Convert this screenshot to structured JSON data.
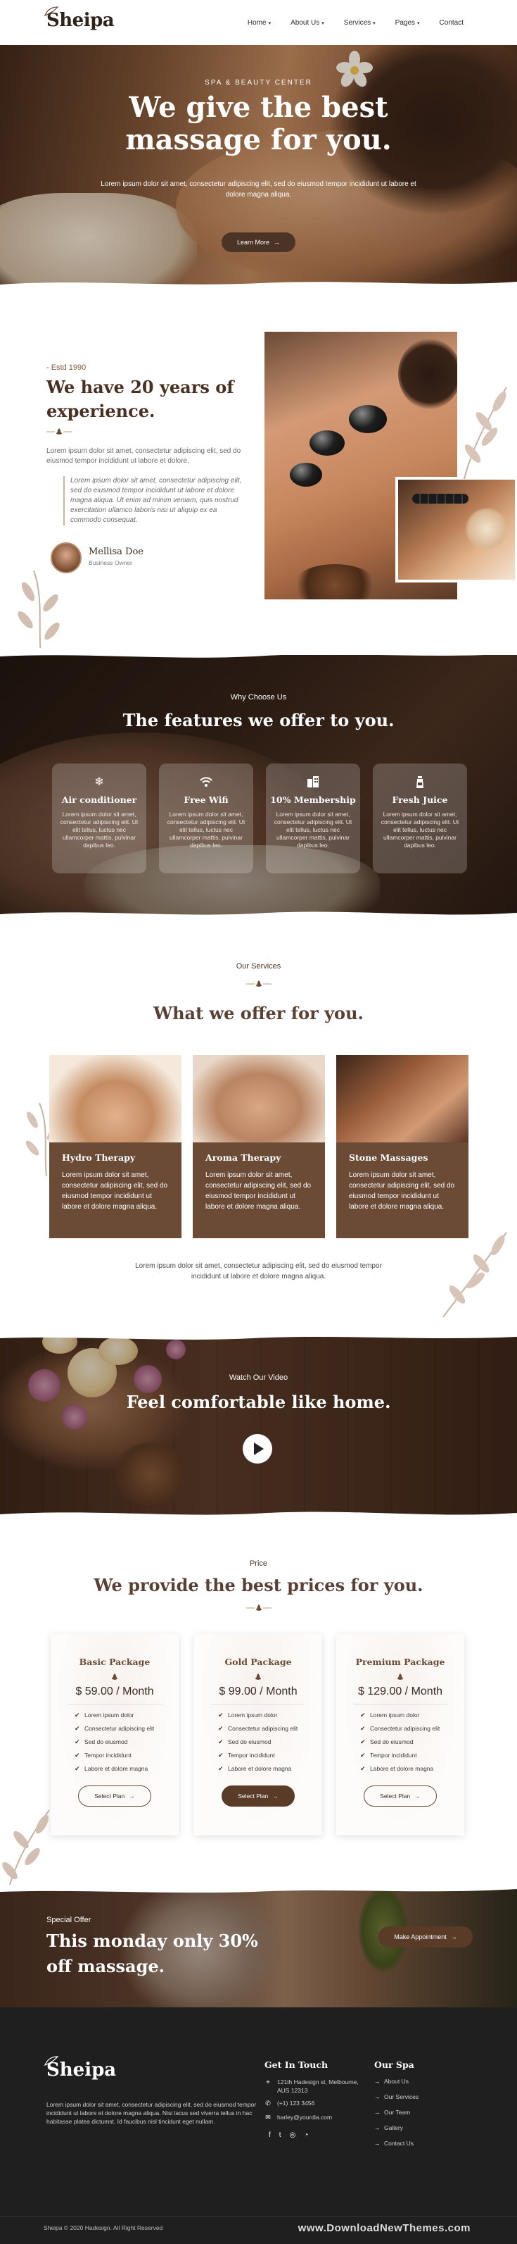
{
  "brand": {
    "logo_text": "Sheipa"
  },
  "nav": {
    "items": [
      {
        "label": "Home",
        "has_dropdown": true
      },
      {
        "label": "About Us",
        "has_dropdown": true
      },
      {
        "label": "Services",
        "has_dropdown": true
      },
      {
        "label": "Pages",
        "has_dropdown": true
      },
      {
        "label": "Contact",
        "has_dropdown": false
      }
    ]
  },
  "hero": {
    "eyebrow": "SPA & BEAUTY CENTER",
    "title_line1": "We give the best",
    "title_line2": "massage for you.",
    "text": "Lorem ipsum dolor sit amet, consectetur adipiscing elit, sed do eiusmod tempor incididunt ut labore et dolore magna aliqua.",
    "button": "Learn More"
  },
  "about": {
    "estd": "- Estd 1990",
    "title": "We have 20 years of experience.",
    "paragraph": "Lorem ipsum dolor sit amet, consectetur adipiscing elit, sed do eiusmod tempor incididunt ut labore et dolore.",
    "quote": "Lorem ipsum dolor sit amet, consectetur adipiscing elit, sed do eiusmod tempor incididunt ut labore et dolore magna aliqua. Ut enim ad minim veniam, quis nostrud exercitation ullamco laboris nisi ut aliquip ex ea commodo consequat.",
    "author_name": "Mellisa Doe",
    "author_role": "Business Owner"
  },
  "features": {
    "eyebrow": "Why Choose Us",
    "title": "The features we offer to you.",
    "cards": [
      {
        "icon": "snowflake-icon",
        "title": "Air conditioner",
        "text": "Lorem ipsum dolor sit amet, consectetur adipiscing elit. Ut elit tellus, luctus nec ullamcorper mattis, pulvinar dapibus leo."
      },
      {
        "icon": "wifi-icon",
        "title": "Free Wifi",
        "text": "Lorem ipsum dolor sit amet, consectetur adipiscing elit. Ut elit tellus, luctus nec ullamcorper mattis, pulvinar dapibus leo."
      },
      {
        "icon": "building-icon",
        "title": "10% Membership",
        "text": "Lorem ipsum dolor sit amet, consectetur adipiscing elit. Ut elit tellus, luctus nec ullamcorper mattis, pulvinar dapibus leo."
      },
      {
        "icon": "juice-icon",
        "title": "Fresh Juice",
        "text": "Lorem ipsum dolor sit amet, consectetur adipiscing elit. Ut elit tellus, luctus nec ullamcorper mattis, pulvinar dapibus leo."
      }
    ]
  },
  "services": {
    "eyebrow": "Our Services",
    "title": "What we offer for you.",
    "cards": [
      {
        "title": "Hydro Therapy",
        "text": "Lorem ipsum dolor sit amet, consectetur adipiscing elit, sed do eiusmod tempor incididunt ut labore et dolore magna aliqua."
      },
      {
        "title": "Aroma Therapy",
        "text": "Lorem ipsum dolor sit amet, consectetur adipiscing elit, sed do eiusmod tempor incididunt ut labore et dolore magna aliqua."
      },
      {
        "title": "Stone Massages",
        "text": "Lorem ipsum dolor sit amet, consectetur adipiscing elit, sed do eiusmod tempor incididunt ut labore et dolore magna aliqua."
      }
    ],
    "note": "Lorem ipsum dolor sit amet, consectetur adipiscing elit, sed do eiusmod tempor incididunt ut labore et dolore magna aliqua."
  },
  "video": {
    "eyebrow": "Watch Our Video",
    "title": "Feel comfortable like home."
  },
  "pricing": {
    "eyebrow": "Price",
    "title": "We provide the best prices for you.",
    "plans": [
      {
        "name": "Basic Package",
        "price": "$ 59.00 / Month",
        "button": "Select Plan"
      },
      {
        "name": "Gold Package",
        "price": "$ 99.00 / Month",
        "button": "Select Plan"
      },
      {
        "name": "Premium Package",
        "price": "$ 129.00 / Month",
        "button": "Select Plan"
      }
    ],
    "features": [
      "Lorem ipsum dolor",
      "Consectetur adipiscing elit",
      "Sed do eiusmod",
      "Tempor incididunt",
      "Labore et dolore magna"
    ]
  },
  "offer": {
    "eyebrow": "Special Offer",
    "title": "This monday only 30% off massage.",
    "button": "Make Appointment"
  },
  "footer": {
    "logo_text": "Sheipa",
    "about": "Lorem ipsum dolor sit amet, consectetur adipiscing elit, sed do eiusmod tempor incididunt ut labore et dolore magna aliqua. Nisi lacus sed viverra tellus in hac habitasse platea dictumst. Id faucibus nisl tincidunt eget nullam.",
    "contact_title": "Get In Touch",
    "address_line1": "121th Hadesign st, Melbourne,",
    "address_line2": "AUS 12313",
    "phone": "(+1) 123 3456",
    "email": "harley@yourdia.com",
    "links_title": "Our Spa",
    "links": [
      "About Us",
      "Our Services",
      "Our Team",
      "Gallery",
      "Contact Us"
    ],
    "copyright": "Sheipa © 2020 Hadesign. All Right Reserved",
    "watermark": "www.DownloadNewThemes.com"
  }
}
